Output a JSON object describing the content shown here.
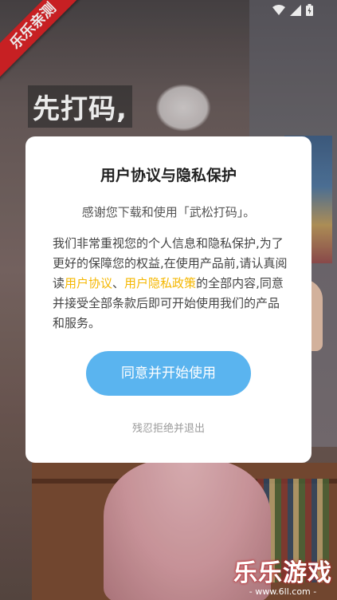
{
  "background": {
    "headline": "先打码,"
  },
  "ribbon": {
    "label": "乐乐亲测"
  },
  "watermark": {
    "title": "乐乐游戏",
    "url": "- www.6ll.com -"
  },
  "icons": {
    "wifi": "wifi-icon",
    "signal": "signal-icon",
    "battery": "battery-icon"
  },
  "dialog": {
    "title": "用户协议与隐私保护",
    "thanks": "感谢您下载和使用「武松打码」。",
    "body_line1": "我们非常重视您的个人信息和隐私保护,为了更好的保障您的权益,在使用产品前,请认真阅读",
    "link_agreement": "用户协议",
    "separator": "、",
    "link_privacy": "用户隐私政策",
    "body_line2": "的全部内容,同意并接受全部条款后即可开始使用我们的产品和服务。",
    "agree_label": "同意并开始使用",
    "decline_label": "残忍拒绝并退出"
  },
  "colors": {
    "accent_button": "#5ab4ef",
    "link": "#f5b700",
    "ribbon": "#d82327"
  }
}
